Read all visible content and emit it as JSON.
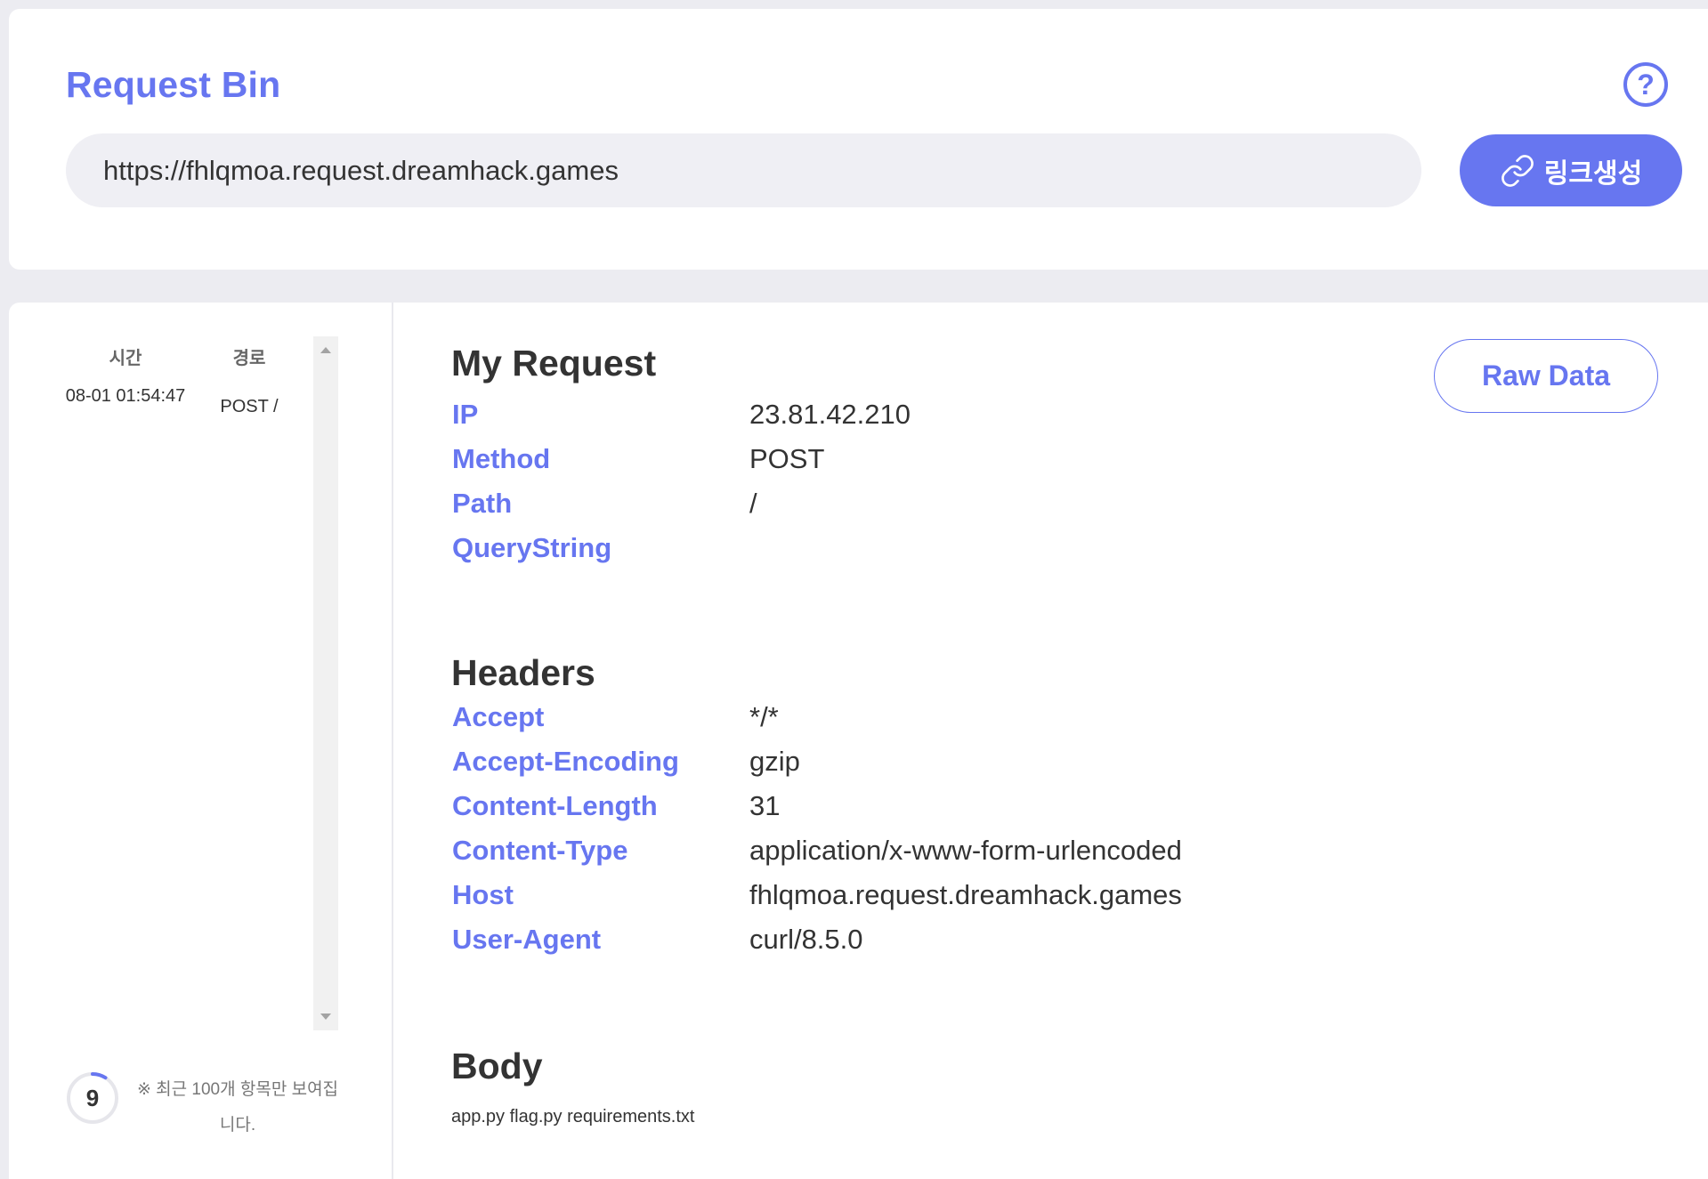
{
  "header": {
    "title": "Request Bin",
    "help_icon": "question-circle-icon",
    "url_value": "https://fhlqmoa.request.dreamhack.games",
    "generate_label": "링크생성",
    "generate_icon": "link-icon"
  },
  "history": {
    "col_time": "시간",
    "col_path": "경로",
    "rows": [
      {
        "time": "08-01 01:54:47",
        "path": "POST /"
      }
    ],
    "count": "9",
    "count_progress": 0.09,
    "notice": "※ 최근 100개 항목만 보여집니다."
  },
  "request": {
    "section_title": "My Request",
    "raw_button": "Raw Data",
    "fields": [
      {
        "key": "IP",
        "value": "23.81.42.210"
      },
      {
        "key": "Method",
        "value": "POST"
      },
      {
        "key": "Path",
        "value": "/"
      },
      {
        "key": "QueryString",
        "value": ""
      }
    ]
  },
  "headers": {
    "section_title": "Headers",
    "fields": [
      {
        "key": "Accept",
        "value": "*/*"
      },
      {
        "key": "Accept-Encoding",
        "value": "gzip"
      },
      {
        "key": "Content-Length",
        "value": "31"
      },
      {
        "key": "Content-Type",
        "value": "application/x-www-form-urlencoded"
      },
      {
        "key": "Host",
        "value": "fhlqmoa.request.dreamhack.games"
      },
      {
        "key": "User-Agent",
        "value": "curl/8.5.0"
      }
    ]
  },
  "body": {
    "section_title": "Body",
    "content": "app.py flag.py requirements.txt"
  },
  "colors": {
    "accent": "#6776f0",
    "background": "#ececf1",
    "card": "#ffffff",
    "input_bg": "#efeff4"
  }
}
